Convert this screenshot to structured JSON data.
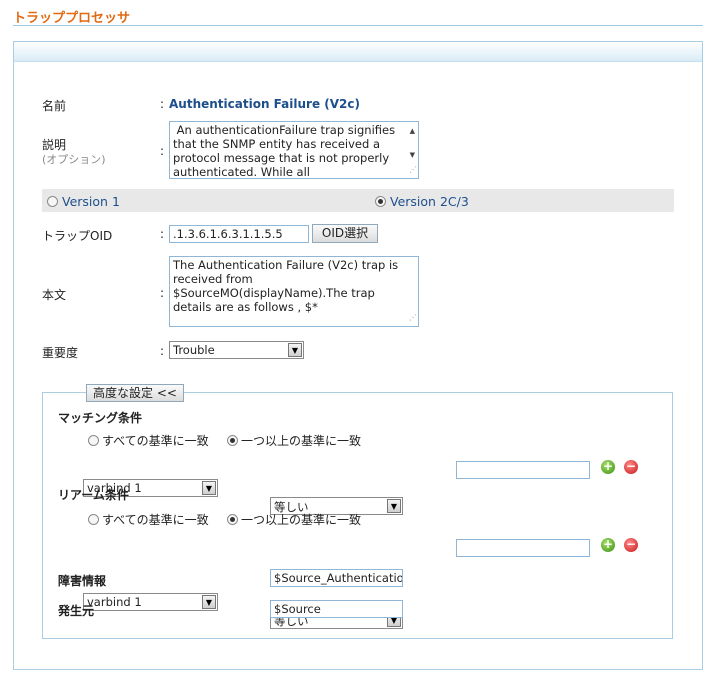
{
  "page": {
    "title": "トラッププロセッサ"
  },
  "form": {
    "name": {
      "label": "名前",
      "value": "Authentication Failure (V2c)"
    },
    "description": {
      "label": "説明",
      "sublabel": "(オプション)",
      "value": " An authenticationFailure trap signifies that the SNMP entity has received a protocol message that is not properly authenticated. While all"
    },
    "version": {
      "v1_label": "Version 1",
      "v2_label": "Version 2C/3",
      "selected": "Version 2C/3"
    },
    "trap_oid": {
      "label": "トラップOID",
      "value": ".1.3.6.1.6.3.1.1.5.5",
      "button": "OID選択"
    },
    "body": {
      "label": "本文",
      "value": "The Authentication Failure (V2c) trap is received from $SourceMO(displayName).The trap details are as follows , $*"
    },
    "severity": {
      "label": "重要度",
      "value": "Trouble"
    },
    "colon": ":"
  },
  "advanced": {
    "toggle_label": "高度な設定 <<",
    "matching": {
      "title": "マッチング条件",
      "all_label": "すべての基準に一致",
      "any_label": "一つ以上の基準に一致",
      "selected": "any",
      "field": "varbind 1",
      "operator": "等しい",
      "value": ""
    },
    "rearm": {
      "title": "リアーム条件",
      "all_label": "すべての基準に一致",
      "any_label": "一つ以上の基準に一致",
      "selected": "any",
      "field": "varbind 1",
      "operator": "等しい",
      "value": ""
    },
    "failure_info": {
      "label": "障害情報",
      "value": "$Source_Authentication"
    },
    "source": {
      "label": "発生元",
      "value": "$Source"
    }
  },
  "icons": {
    "add": "plus-circle-icon",
    "remove": "minus-circle-icon"
  },
  "colors": {
    "title": "#e06a13",
    "accent": "#1d4f8c",
    "border": "#a9cde3"
  }
}
